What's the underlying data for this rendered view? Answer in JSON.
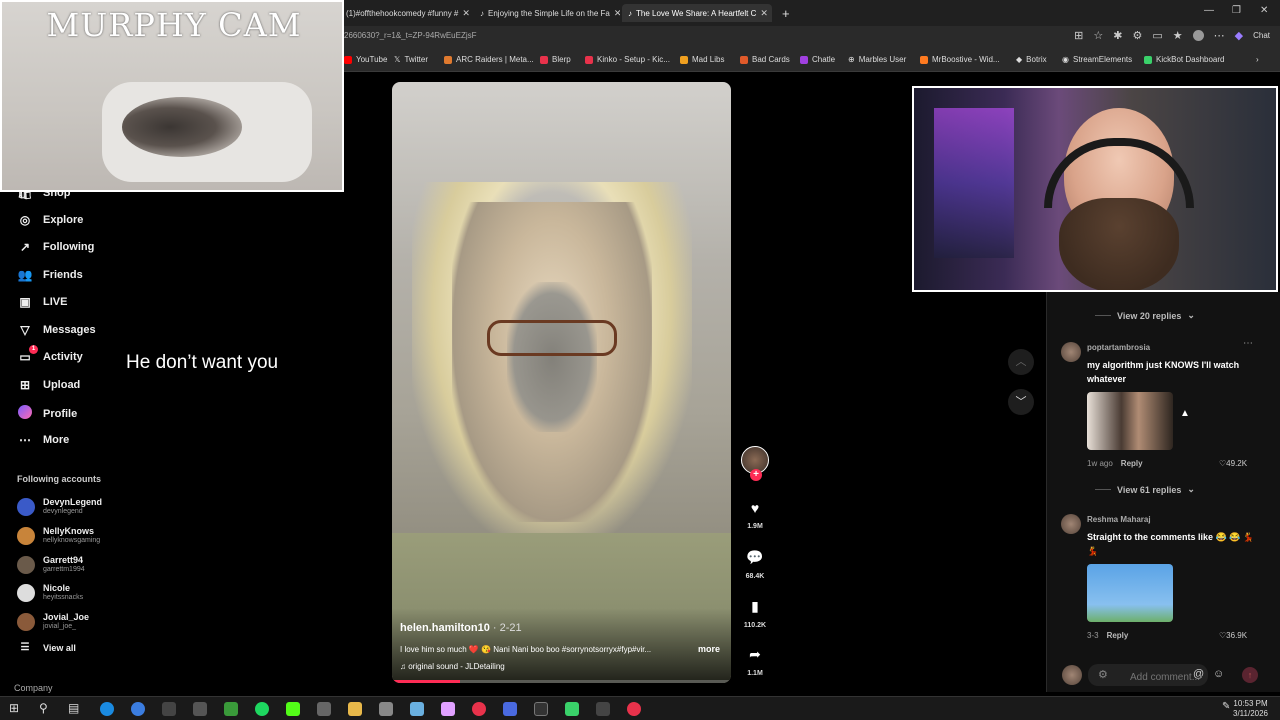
{
  "browser": {
    "tabs": [
      {
        "label": "(1)#offthehookcomedy #funny #"
      },
      {
        "label": "Enjoying the Simple Life on the Fa"
      },
      {
        "label": "The Love We Share: A Heartfelt C"
      }
    ],
    "url": "2660630?_r=1&_t=ZP-94RwEuEZjsF",
    "chat_label": "Chat",
    "bookmarks": [
      {
        "label": "YouTube",
        "color": "#ff0000"
      },
      {
        "label": "Twitter",
        "color": "#ffffff"
      },
      {
        "label": "ARC Raiders | Meta...",
        "color": "#e07a2f"
      },
      {
        "label": "Blerp",
        "color": "#e8324b"
      },
      {
        "label": "Kinko - Setup - Kic...",
        "color": "#e8324b"
      },
      {
        "label": "Mad Libs",
        "color": "#f0a020"
      },
      {
        "label": "Bad Cards",
        "color": "#e05a2a"
      },
      {
        "label": "Chatle",
        "color": "#a040e0"
      },
      {
        "label": "Marbles User",
        "color": "#cccccc"
      },
      {
        "label": "MrBoostive - Wid...",
        "color": "#ff7a20"
      },
      {
        "label": "Botrix",
        "color": "#ffffff"
      },
      {
        "label": "StreamElements",
        "color": "#ffffff"
      },
      {
        "label": "KickBot Dashboard",
        "color": "#3ad16a"
      }
    ]
  },
  "overlay": {
    "murphy_cam_title": "MURPHY CAM"
  },
  "sidebar": {
    "partial_item": "Shop",
    "items": [
      {
        "label": "Explore",
        "icon": "compass-icon"
      },
      {
        "label": "Following",
        "icon": "arrow-icon"
      },
      {
        "label": "Friends",
        "icon": "friends-icon"
      },
      {
        "label": "LIVE",
        "icon": "live-icon"
      },
      {
        "label": "Messages",
        "icon": "messages-icon"
      },
      {
        "label": "Activity",
        "icon": "activity-icon",
        "badge": "1"
      },
      {
        "label": "Upload",
        "icon": "upload-icon"
      },
      {
        "label": "Profile",
        "icon": "profile-icon"
      },
      {
        "label": "More",
        "icon": "more-icon"
      }
    ],
    "following_title": "Following accounts",
    "accounts": [
      {
        "name": "DevynLegend",
        "handle": "devynlegend"
      },
      {
        "name": "NellyKnows",
        "handle": "nellyknowsgaming"
      },
      {
        "name": "Garrett94",
        "handle": "garrettm1994"
      },
      {
        "name": "Nicole",
        "handle": "heyitssnacks"
      },
      {
        "name": "Jovial_Joe",
        "handle": "jovial_joe_"
      }
    ],
    "view_all": "View all",
    "company": "Company"
  },
  "video": {
    "caption": "He don’t want you",
    "author": "helen.hamilton10",
    "date": " · 2-21",
    "description": "I love him so much ❤️ 😘 Nani Nani boo boo #sorrynotsorryx#fyp#vir...",
    "more": "more",
    "sound": "original sound - JLDetailing",
    "progress": 0.2
  },
  "actions": {
    "likes": "1.9M",
    "comments": "68.4K",
    "saves": "110.2K",
    "shares": "1.1M"
  },
  "comments": {
    "view_replies_1": "View 20 replies",
    "items": [
      {
        "user": "poptartambrosia",
        "text": "my algorithm just KNOWS I'll watch whatever",
        "time": "1w ago",
        "reply": "Reply",
        "likes": "49.2K",
        "view_replies": "View 61 replies"
      },
      {
        "user": "Reshma Maharaj",
        "text": "Straight to the comments like 😂 😂 💃 💃",
        "time": "3-3",
        "reply": "Reply",
        "likes": "36.9K"
      }
    ],
    "add_placeholder": "Add comment..."
  },
  "taskbar": {
    "time": "10:53 PM",
    "date": "3/11/2026"
  }
}
